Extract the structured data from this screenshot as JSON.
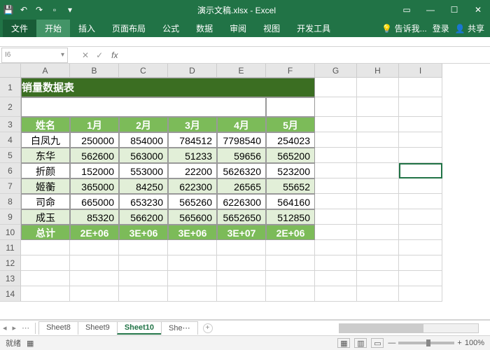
{
  "titlebar": {
    "title": "演示文稿.xlsx - Excel"
  },
  "ribbon": {
    "tabs": [
      "文件",
      "开始",
      "插入",
      "页面布局",
      "公式",
      "数据",
      "审阅",
      "视图",
      "开发工具"
    ],
    "tell": "告诉我...",
    "login": "登录",
    "share": "共享"
  },
  "namebox": {
    "cell": "I6"
  },
  "chart_data": {
    "type": "table",
    "title": "销量数据表",
    "columns": [
      "姓名",
      "1月",
      "2月",
      "3月",
      "4月",
      "5月"
    ],
    "rows": [
      {
        "name": "白凤九",
        "values": [
          250000,
          854000,
          784512,
          7798540,
          254023
        ]
      },
      {
        "name": "东华",
        "values": [
          562600,
          563000,
          51233,
          59656,
          565200
        ]
      },
      {
        "name": "折颜",
        "values": [
          152000,
          553000,
          22200,
          5626320,
          523200
        ]
      },
      {
        "name": "姬蘅",
        "values": [
          365000,
          84250,
          622300,
          26565,
          55652
        ]
      },
      {
        "name": "司命",
        "values": [
          665000,
          653230,
          565260,
          6226300,
          564160
        ]
      },
      {
        "name": "成玉",
        "values": [
          85320,
          566200,
          565600,
          5652650,
          512850
        ]
      }
    ],
    "totals": {
      "label": "总计",
      "values": [
        "2E+06",
        "3E+06",
        "3E+06",
        "3E+07",
        "2E+06"
      ]
    }
  },
  "columns": [
    "",
    "A",
    "B",
    "C",
    "D",
    "E",
    "F",
    "G",
    "H",
    "I"
  ],
  "sheets": {
    "items": [
      "Sheet8",
      "Sheet9",
      "Sheet10",
      "She⋯"
    ],
    "active": "Sheet10"
  },
  "status": {
    "ready": "就绪",
    "zoom": "100%"
  }
}
